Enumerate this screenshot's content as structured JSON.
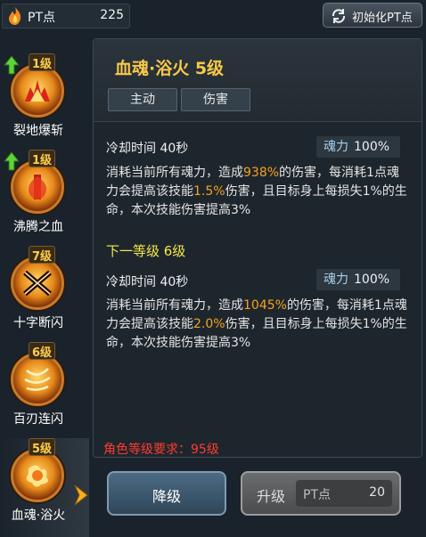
{
  "top_bar": {
    "pt_label": "PT点",
    "pt_value": "225",
    "reset_label": "初始化PT点"
  },
  "skills": [
    {
      "level": "1级",
      "name": "裂地爆斩",
      "upgradable": true
    },
    {
      "level": "1级",
      "name": "沸腾之血",
      "upgradable": true
    },
    {
      "level": "7级",
      "name": "十字断闪",
      "upgradable": false
    },
    {
      "level": "6级",
      "name": "百刃连闪",
      "upgradable": false
    },
    {
      "level": "5级",
      "name": "血魂·浴火",
      "upgradable": false,
      "selected": true
    }
  ],
  "detail": {
    "title": "血魂·浴火 5级",
    "tags": [
      "主动",
      "伤害"
    ],
    "current": {
      "cooldown": "冷却时间 40秒",
      "cost_key": "魂力",
      "cost_value": "100%",
      "desc_parts": [
        "消耗当前所有魂力，造成",
        "938%",
        "的伤害，每消耗1点魂力会提高该技能",
        "1.5%",
        "伤害，且目标身上每损失1%的生命，本次技能伤害提高3%"
      ]
    },
    "next_title": "下一等级 6级",
    "next": {
      "cooldown": "冷却时间 40秒",
      "cost_key": "魂力",
      "cost_value": "100%",
      "desc_parts": [
        "消耗当前所有魂力，造成",
        "1045%",
        "的伤害，每消耗1点魂力会提高该技能",
        "2.0%",
        "伤害，且目标身上每损失1%的生命，本次技能伤害提高3%"
      ]
    },
    "requirement": "角色等级要求：95级"
  },
  "buttons": {
    "downgrade": "降级",
    "upgrade": "升级",
    "upgrade_cost_label": "PT点",
    "upgrade_cost_value": "20"
  },
  "colors": {
    "highlight": "#f5a21e",
    "title": "#f7c84a",
    "next_title": "#f3e64a",
    "requirement": "#ff3b2f"
  }
}
